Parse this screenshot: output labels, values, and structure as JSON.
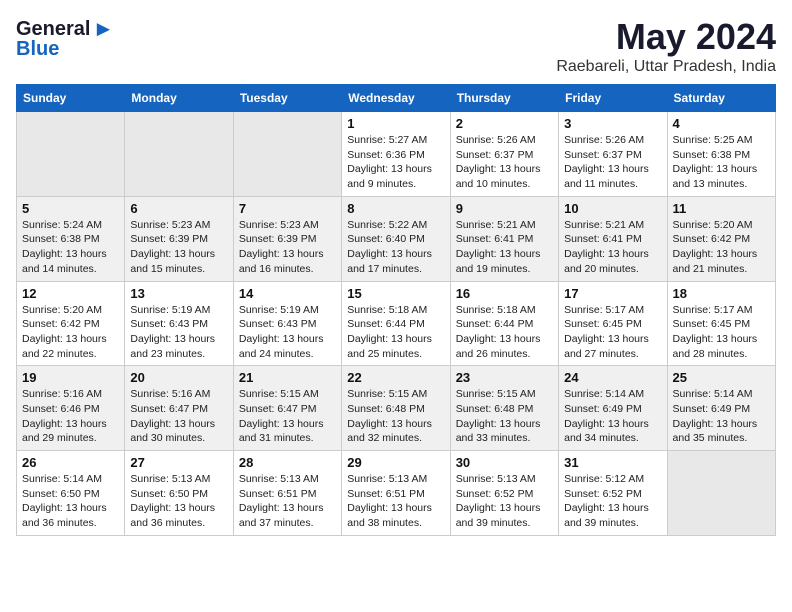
{
  "logo": {
    "general": "General",
    "blue": "Blue"
  },
  "title": {
    "month_year": "May 2024",
    "location": "Raebareli, Uttar Pradesh, India"
  },
  "headers": [
    "Sunday",
    "Monday",
    "Tuesday",
    "Wednesday",
    "Thursday",
    "Friday",
    "Saturday"
  ],
  "weeks": [
    [
      {
        "day": "",
        "info": ""
      },
      {
        "day": "",
        "info": ""
      },
      {
        "day": "",
        "info": ""
      },
      {
        "day": "1",
        "info": "Sunrise: 5:27 AM\nSunset: 6:36 PM\nDaylight: 13 hours and 9 minutes."
      },
      {
        "day": "2",
        "info": "Sunrise: 5:26 AM\nSunset: 6:37 PM\nDaylight: 13 hours and 10 minutes."
      },
      {
        "day": "3",
        "info": "Sunrise: 5:26 AM\nSunset: 6:37 PM\nDaylight: 13 hours and 11 minutes."
      },
      {
        "day": "4",
        "info": "Sunrise: 5:25 AM\nSunset: 6:38 PM\nDaylight: 13 hours and 13 minutes."
      }
    ],
    [
      {
        "day": "5",
        "info": "Sunrise: 5:24 AM\nSunset: 6:38 PM\nDaylight: 13 hours and 14 minutes."
      },
      {
        "day": "6",
        "info": "Sunrise: 5:23 AM\nSunset: 6:39 PM\nDaylight: 13 hours and 15 minutes."
      },
      {
        "day": "7",
        "info": "Sunrise: 5:23 AM\nSunset: 6:39 PM\nDaylight: 13 hours and 16 minutes."
      },
      {
        "day": "8",
        "info": "Sunrise: 5:22 AM\nSunset: 6:40 PM\nDaylight: 13 hours and 17 minutes."
      },
      {
        "day": "9",
        "info": "Sunrise: 5:21 AM\nSunset: 6:41 PM\nDaylight: 13 hours and 19 minutes."
      },
      {
        "day": "10",
        "info": "Sunrise: 5:21 AM\nSunset: 6:41 PM\nDaylight: 13 hours and 20 minutes."
      },
      {
        "day": "11",
        "info": "Sunrise: 5:20 AM\nSunset: 6:42 PM\nDaylight: 13 hours and 21 minutes."
      }
    ],
    [
      {
        "day": "12",
        "info": "Sunrise: 5:20 AM\nSunset: 6:42 PM\nDaylight: 13 hours and 22 minutes."
      },
      {
        "day": "13",
        "info": "Sunrise: 5:19 AM\nSunset: 6:43 PM\nDaylight: 13 hours and 23 minutes."
      },
      {
        "day": "14",
        "info": "Sunrise: 5:19 AM\nSunset: 6:43 PM\nDaylight: 13 hours and 24 minutes."
      },
      {
        "day": "15",
        "info": "Sunrise: 5:18 AM\nSunset: 6:44 PM\nDaylight: 13 hours and 25 minutes."
      },
      {
        "day": "16",
        "info": "Sunrise: 5:18 AM\nSunset: 6:44 PM\nDaylight: 13 hours and 26 minutes."
      },
      {
        "day": "17",
        "info": "Sunrise: 5:17 AM\nSunset: 6:45 PM\nDaylight: 13 hours and 27 minutes."
      },
      {
        "day": "18",
        "info": "Sunrise: 5:17 AM\nSunset: 6:45 PM\nDaylight: 13 hours and 28 minutes."
      }
    ],
    [
      {
        "day": "19",
        "info": "Sunrise: 5:16 AM\nSunset: 6:46 PM\nDaylight: 13 hours and 29 minutes."
      },
      {
        "day": "20",
        "info": "Sunrise: 5:16 AM\nSunset: 6:47 PM\nDaylight: 13 hours and 30 minutes."
      },
      {
        "day": "21",
        "info": "Sunrise: 5:15 AM\nSunset: 6:47 PM\nDaylight: 13 hours and 31 minutes."
      },
      {
        "day": "22",
        "info": "Sunrise: 5:15 AM\nSunset: 6:48 PM\nDaylight: 13 hours and 32 minutes."
      },
      {
        "day": "23",
        "info": "Sunrise: 5:15 AM\nSunset: 6:48 PM\nDaylight: 13 hours and 33 minutes."
      },
      {
        "day": "24",
        "info": "Sunrise: 5:14 AM\nSunset: 6:49 PM\nDaylight: 13 hours and 34 minutes."
      },
      {
        "day": "25",
        "info": "Sunrise: 5:14 AM\nSunset: 6:49 PM\nDaylight: 13 hours and 35 minutes."
      }
    ],
    [
      {
        "day": "26",
        "info": "Sunrise: 5:14 AM\nSunset: 6:50 PM\nDaylight: 13 hours and 36 minutes."
      },
      {
        "day": "27",
        "info": "Sunrise: 5:13 AM\nSunset: 6:50 PM\nDaylight: 13 hours and 36 minutes."
      },
      {
        "day": "28",
        "info": "Sunrise: 5:13 AM\nSunset: 6:51 PM\nDaylight: 13 hours and 37 minutes."
      },
      {
        "day": "29",
        "info": "Sunrise: 5:13 AM\nSunset: 6:51 PM\nDaylight: 13 hours and 38 minutes."
      },
      {
        "day": "30",
        "info": "Sunrise: 5:13 AM\nSunset: 6:52 PM\nDaylight: 13 hours and 39 minutes."
      },
      {
        "day": "31",
        "info": "Sunrise: 5:12 AM\nSunset: 6:52 PM\nDaylight: 13 hours and 39 minutes."
      },
      {
        "day": "",
        "info": ""
      }
    ]
  ]
}
